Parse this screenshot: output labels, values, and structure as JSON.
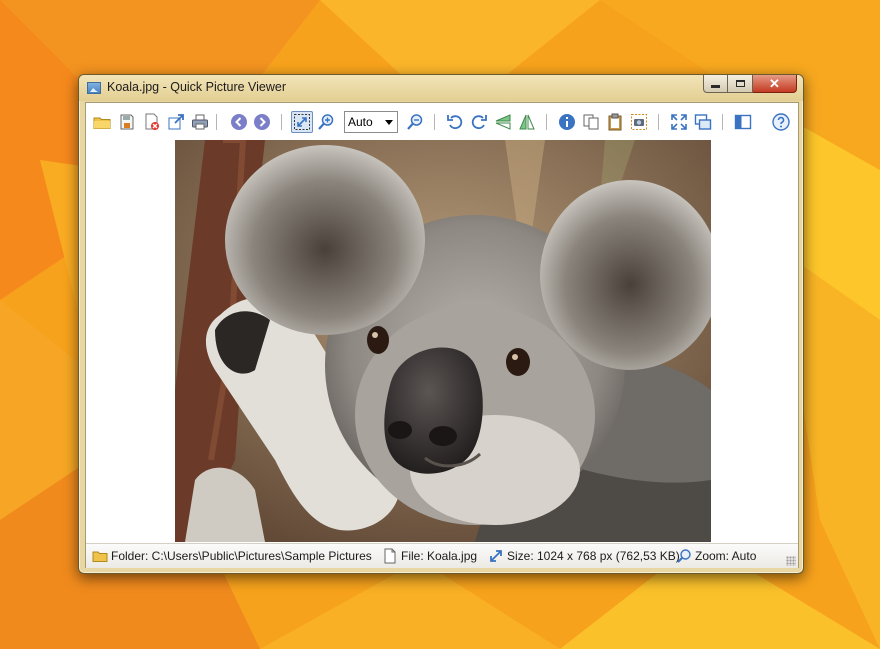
{
  "window": {
    "title": "Koala.jpg - Quick Picture Viewer"
  },
  "toolbar": {
    "zoom_value": "Auto",
    "buttons": [
      "open-folder",
      "save",
      "delete",
      "open-with",
      "print",
      "previous",
      "next",
      "auto-zoom",
      "zoom-in",
      "zoom-out",
      "rotate-left",
      "rotate-right",
      "flip-vertical",
      "flip-horizontal",
      "info",
      "copy",
      "paste",
      "screenshot",
      "fullscreen",
      "slideshow",
      "settings",
      "help"
    ]
  },
  "image": {
    "file": "Koala.jpg",
    "subject": "koala"
  },
  "statusbar": {
    "folder": "Folder: C:\\Users\\Public\\Pictures\\Sample Pictures",
    "file": "File: Koala.jpg",
    "size": "Size: 1024 x 768 px (762,53 KB)",
    "zoom": "Zoom: Auto"
  },
  "colors": {
    "wallpaper": "#f7a21c",
    "window_frame": "#e9d7a3",
    "accent_blue": "#3a73c2",
    "close_red": "#c43b22"
  }
}
